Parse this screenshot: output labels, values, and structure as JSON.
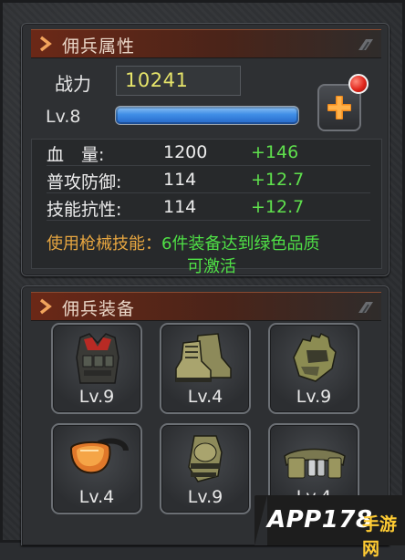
{
  "attr_panel": {
    "title": "佣兵属性",
    "power_label": "战力",
    "power_value": "10241",
    "level_label": "Lv.8",
    "level_progress_fraction": 0.98,
    "stats": [
      {
        "label": "血　量:",
        "value": "1200",
        "bonus": "+146"
      },
      {
        "label": "普攻防御:",
        "value": "114",
        "bonus": "+12.7"
      },
      {
        "label": "技能抗性:",
        "value": "114",
        "bonus": "+12.7"
      }
    ],
    "note_label": "使用枪械技能：",
    "note_text_1": "6件装备达到绿色品质",
    "note_text_2": "可激活"
  },
  "equip_panel": {
    "title": "佣兵装备",
    "slots": [
      {
        "icon": "armor-vest-icon",
        "level": "Lv.9"
      },
      {
        "icon": "combat-boots-icon",
        "level": "Lv.4"
      },
      {
        "icon": "tactical-gloves-icon",
        "level": "Lv.9"
      },
      {
        "icon": "goggles-icon",
        "level": "Lv.4"
      },
      {
        "icon": "knee-pads-icon",
        "level": "Lv.9"
      },
      {
        "icon": "utility-belt-icon",
        "level": "Lv.4"
      }
    ]
  },
  "watermark": {
    "brand": "APP178",
    "site": "手游网"
  },
  "colors": {
    "bonus_green": "#5fe04d",
    "note_orange": "#e7a640",
    "power_yellow": "#e6e46a",
    "header_red": "#6b2817",
    "plus_orange": "#f08a1c",
    "level_blue": "#3f8ee6"
  }
}
